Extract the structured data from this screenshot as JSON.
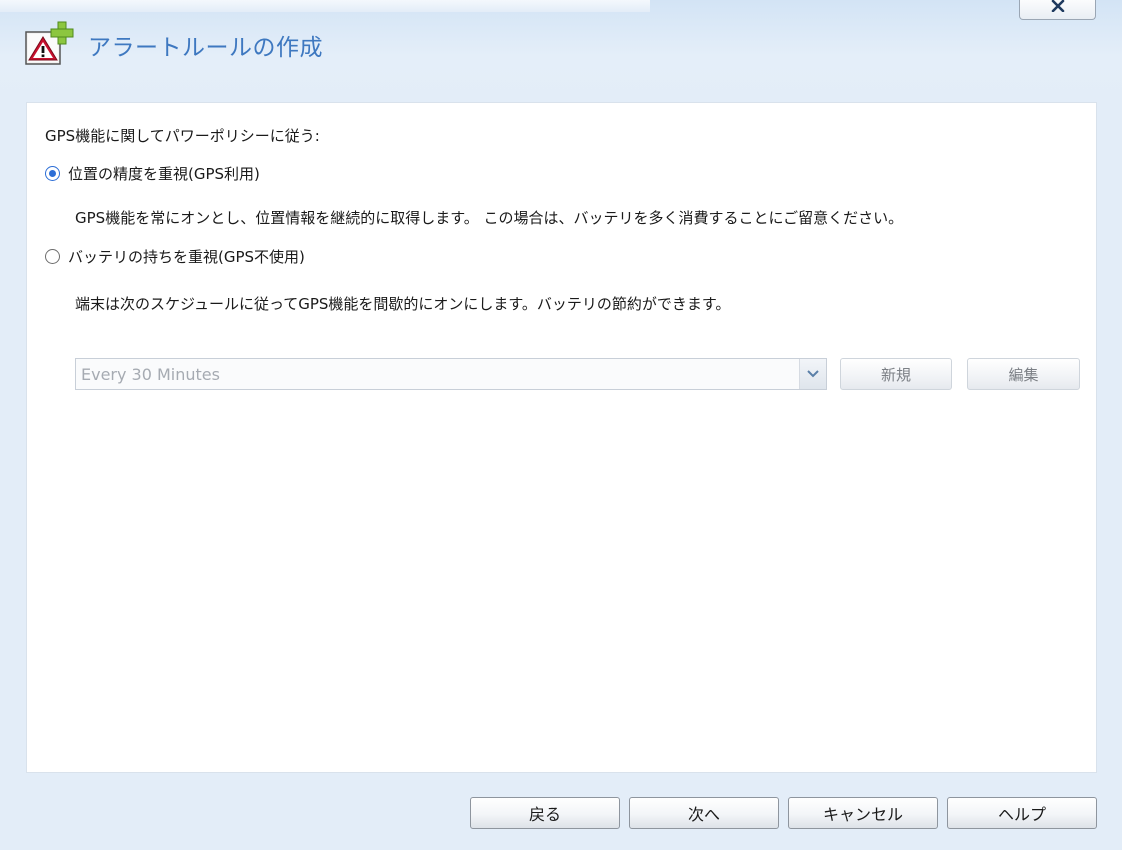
{
  "dialog": {
    "title": "アラートルールの作成",
    "icon": "alert-rule-add-icon",
    "close_icon": "close-icon",
    "close_label": "✕"
  },
  "policy": {
    "label": "GPS機能に関してパワーポリシーに従う:",
    "options": [
      {
        "label": "位置の精度を重視(GPS利用)",
        "checked": true,
        "description": "GPS機能を常にオンとし、位置情報を継続的に取得します。 この場合は、バッテリを多く消費することにご留意ください。"
      },
      {
        "label": "バッテリの持ちを重視(GPS不使用)",
        "checked": false,
        "description": "端末は次のスケジュールに従ってGPS機能を間歇的にオンにします。バッテリの節約ができます。"
      }
    ]
  },
  "schedule": {
    "selected": "Every 30 Minutes",
    "new_label": "新規",
    "edit_label": "編集",
    "disabled": true
  },
  "footer": {
    "back_label": "戻る",
    "next_label": "次へ",
    "cancel_label": "キャンセル",
    "help_label": "ヘルプ"
  },
  "colors": {
    "accent": "#2c6ed6",
    "title": "#3e78c0",
    "background": "#e3edf8"
  }
}
